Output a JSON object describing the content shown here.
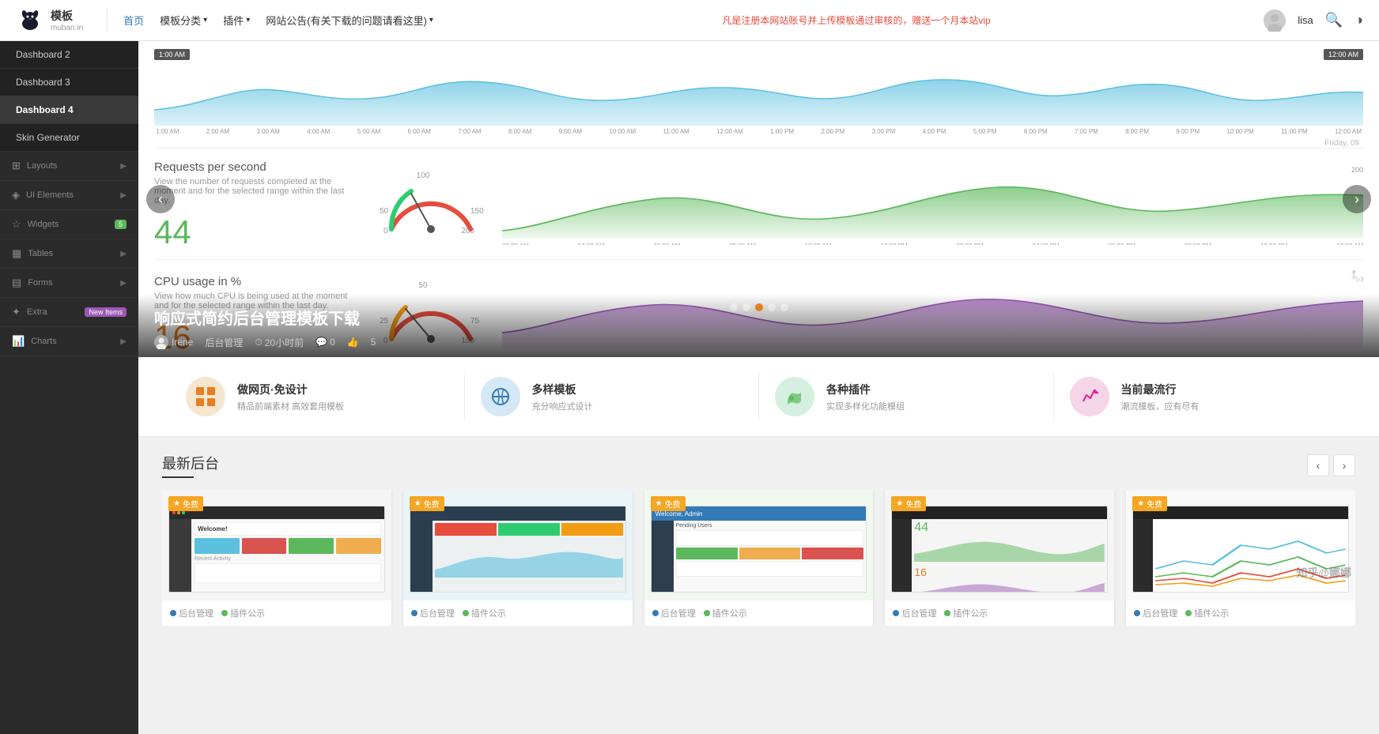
{
  "header": {
    "logo_text": "模板",
    "logo_sub": "muban.in",
    "nav": [
      {
        "label": "首页",
        "active": true
      },
      {
        "label": "模板分类",
        "dropdown": true
      },
      {
        "label": "插件",
        "dropdown": true
      },
      {
        "label": "网站公告(有关下载的问题请看这里)",
        "dropdown": true
      }
    ],
    "notice": "凡是注册本网站账号并上传模板通过审核的，赠送一个月本站vip",
    "user_name": "lisa",
    "search_icon": "🔍",
    "theme_icon": "◑"
  },
  "sidebar": {
    "items": [
      {
        "label": "Dashboard 2",
        "type": "sub",
        "active": false
      },
      {
        "label": "Dashboard 3",
        "type": "sub",
        "active": false
      },
      {
        "label": "Dashboard 4",
        "type": "sub",
        "active": true
      },
      {
        "label": "Skin Generator",
        "type": "sub",
        "active": false
      },
      {
        "label": "Layouts",
        "type": "category",
        "arrow": true
      },
      {
        "label": "UI Elements",
        "type": "category",
        "arrow": true
      },
      {
        "label": "Widgets",
        "type": "category",
        "badge": "5",
        "arrow": true
      },
      {
        "label": "Tables",
        "type": "category",
        "arrow": true
      },
      {
        "label": "Forms",
        "type": "category",
        "arrow": true
      },
      {
        "label": "Extra",
        "type": "category",
        "badge_new": "New Items",
        "arrow": true
      },
      {
        "label": "Charts",
        "type": "category",
        "arrow": true
      }
    ]
  },
  "slideshow": {
    "time_start": "1:00 AM",
    "time_end": "12:00 AM",
    "time_labels": [
      "1:00 AM",
      "2:00 AM",
      "3:00 AM",
      "4:00 AM",
      "5:00 AM",
      "6:00 AM",
      "7:00 AM",
      "8:00 AM",
      "9:00 AM",
      "10:00 AM",
      "11:00 AM",
      "12:00 AM",
      "1:00 PM",
      "2:00 PM",
      "3:00 PM",
      "4:00 PM",
      "5:00 PM",
      "6:00 PM",
      "7:00 PM",
      "8:00 PM",
      "9:00 PM",
      "10:00 PM",
      "11:00 PM",
      "12:00 AM"
    ],
    "date_label": "Friday, 09",
    "section1": {
      "title": "Requests per second",
      "desc": "View the number of requests completed at the moment and for the selected range within the last day.",
      "number": "44",
      "gauge_min": "0",
      "gauge_max": "200",
      "gauge_mid": "100",
      "gauge_value": "44"
    },
    "section2": {
      "title": "CPU usage in %",
      "desc": "View how much CPU is being used at the moment and for the selected range within the last day.",
      "number": "16",
      "gauge_mid": "50"
    },
    "overlay": {
      "title": "响应式简约后台管理模板下载",
      "author": "Irene",
      "category": "后台管理",
      "time": "20小时前",
      "comments": "0",
      "likes": "",
      "views": "5"
    },
    "dots": [
      1,
      2,
      3,
      4,
      5
    ],
    "active_dot": 3
  },
  "features": [
    {
      "icon": "⊞",
      "icon_class": "orange",
      "title": "做网页·免设计",
      "desc": "精品前端素材 高效套用模板"
    },
    {
      "icon": "⊕",
      "icon_class": "blue",
      "title": "多样模板",
      "desc": "充分响应式设计"
    },
    {
      "icon": "⊗",
      "icon_class": "green",
      "title": "各种插件",
      "desc": "实现多样化功能模组"
    },
    {
      "icon": "⊙",
      "icon_class": "pink",
      "title": "当前最流行",
      "desc": "潮流模板，应有尽有"
    }
  ],
  "latest": {
    "section_title": "最新后台",
    "cards": [
      {
        "badge": "免费",
        "type": "后台管理",
        "tags": [
          "后台管理",
          "插件公示"
        ]
      },
      {
        "badge": "免费",
        "type": "后台管理",
        "tags": [
          "后台管理",
          "插件公示"
        ]
      },
      {
        "badge": "免费",
        "type": "后台管理",
        "tags": [
          "后台管理",
          "插件公示"
        ]
      },
      {
        "badge": "免费",
        "type": "后台管理",
        "tags": [
          "后台管理",
          "插件公示"
        ]
      },
      {
        "badge": "免费",
        "type": "后台管理",
        "tags": [
          "后台管理",
          "插件公示"
        ]
      }
    ]
  },
  "watermark": "知乎@娜娜"
}
